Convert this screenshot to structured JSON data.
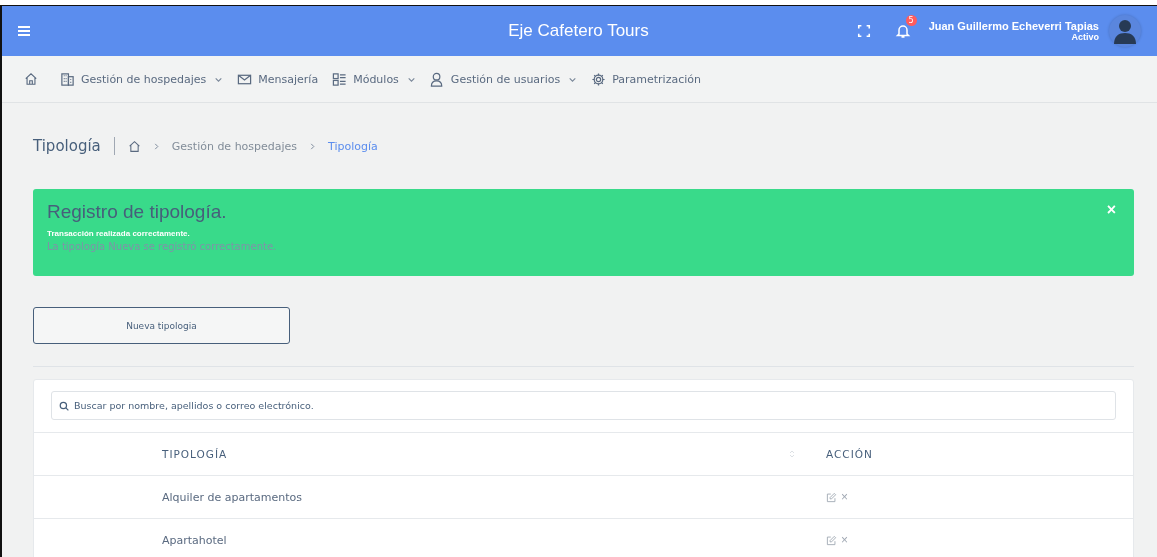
{
  "header": {
    "title": "Eje Cafetero Tours",
    "notifications": "5",
    "user": {
      "name": "Juan Guillermo Echeverri Tapias",
      "status": "Activo"
    }
  },
  "nav": [
    {
      "label": "Gestión de hospedajes",
      "dropdown": true
    },
    {
      "label": "Mensajería",
      "dropdown": false
    },
    {
      "label": "Módulos",
      "dropdown": true
    },
    {
      "label": "Gestión de usuarios",
      "dropdown": true
    },
    {
      "label": "Parametrización",
      "dropdown": false
    }
  ],
  "page": {
    "title": "Tipología",
    "breadcrumb": [
      {
        "label": "Gestión de hospedajes",
        "selected": false
      },
      {
        "label": "Tipología",
        "selected": true
      }
    ]
  },
  "alert": {
    "title": "Registro de tipología.",
    "message": "Transacción realizada correctamente.",
    "detail": "La tipología Nueva se registró correctamente.",
    "close": "×"
  },
  "new_button": "Nueva tipologia",
  "search": {
    "placeholder": "Buscar por nombre, apellidos o correo electrónico."
  },
  "table": {
    "columns": [
      "TIPOLOGÍA",
      "ACCIÓN"
    ],
    "rows": [
      {
        "name": "Alquiler de apartamentos",
        "delete": "×"
      },
      {
        "name": "Apartahotel",
        "delete": "×"
      }
    ]
  }
}
